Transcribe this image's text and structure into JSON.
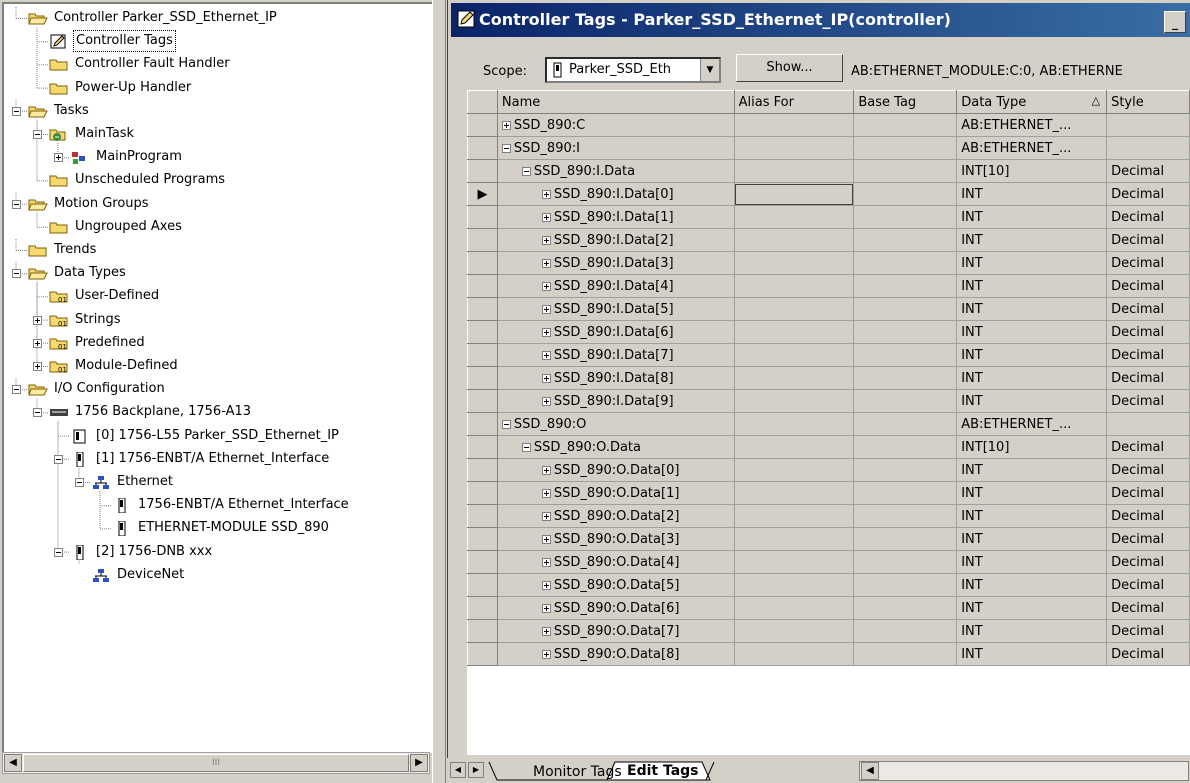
{
  "organizer": {
    "items": [
      {
        "label": "Controller Parker_SSD_Ethernet_IP",
        "icon": "folder-open-icon"
      },
      {
        "label": "Controller Tags",
        "icon": "tags-edit-icon"
      },
      {
        "label": "Controller Fault Handler",
        "icon": "folder-icon"
      },
      {
        "label": "Power-Up Handler",
        "icon": "folder-icon"
      },
      {
        "label": "Tasks",
        "icon": "folder-open-icon"
      },
      {
        "label": "MainTask",
        "icon": "task-icon"
      },
      {
        "label": "MainProgram",
        "icon": "program-icon"
      },
      {
        "label": "Unscheduled Programs",
        "icon": "folder-icon"
      },
      {
        "label": "Motion Groups",
        "icon": "folder-open-icon"
      },
      {
        "label": "Ungrouped Axes",
        "icon": "folder-icon"
      },
      {
        "label": "Trends",
        "icon": "folder-icon"
      },
      {
        "label": "Data Types",
        "icon": "folder-open-icon"
      },
      {
        "label": "User-Defined",
        "icon": "datatype-folder-icon"
      },
      {
        "label": "Strings",
        "icon": "datatype-folder-icon"
      },
      {
        "label": "Predefined",
        "icon": "datatype-folder-icon"
      },
      {
        "label": "Module-Defined",
        "icon": "datatype-folder-icon"
      },
      {
        "label": "I/O Configuration",
        "icon": "folder-open-icon"
      },
      {
        "label": "1756 Backplane, 1756-A13",
        "icon": "backplane-icon"
      },
      {
        "label": "[0] 1756-L55 Parker_SSD_Ethernet_IP",
        "icon": "controller-icon"
      },
      {
        "label": "[1] 1756-ENBT/A Ethernet_Interface",
        "icon": "module-icon"
      },
      {
        "label": "Ethernet",
        "icon": "network-icon"
      },
      {
        "label": "1756-ENBT/A Ethernet_Interface",
        "icon": "module-icon"
      },
      {
        "label": "ETHERNET-MODULE SSD_890",
        "icon": "module-icon"
      },
      {
        "label": "[2] 1756-DNB xxx",
        "icon": "module-icon"
      },
      {
        "label": "DeviceNet",
        "icon": "network-icon"
      }
    ],
    "scroll_thumb_label": "III"
  },
  "window": {
    "title": "Controller Tags - Parker_SSD_Ethernet_IP(controller)",
    "minimize_label": "_"
  },
  "scope": {
    "label": "Scope:",
    "value": "Parker_SSD_Eth",
    "show_button": "Show...",
    "filter_text": "AB:ETHERNET_MODULE:C:0, AB:ETHERNE"
  },
  "grid": {
    "columns": [
      "Name",
      "Alias For",
      "Base Tag",
      "Data Type",
      "Style"
    ],
    "sort_indicator": "△",
    "rows": [
      {
        "name": "SSD_890:C",
        "type": "AB:ETHERNET_...",
        "style": ""
      },
      {
        "name": "SSD_890:I",
        "type": "AB:ETHERNET_...",
        "style": ""
      },
      {
        "name": "SSD_890:I.Data",
        "type": "INT[10]",
        "style": "Decimal"
      },
      {
        "name": "SSD_890:I.Data[0]",
        "type": "INT",
        "style": "Decimal"
      },
      {
        "name": "SSD_890:I.Data[1]",
        "type": "INT",
        "style": "Decimal"
      },
      {
        "name": "SSD_890:I.Data[2]",
        "type": "INT",
        "style": "Decimal"
      },
      {
        "name": "SSD_890:I.Data[3]",
        "type": "INT",
        "style": "Decimal"
      },
      {
        "name": "SSD_890:I.Data[4]",
        "type": "INT",
        "style": "Decimal"
      },
      {
        "name": "SSD_890:I.Data[5]",
        "type": "INT",
        "style": "Decimal"
      },
      {
        "name": "SSD_890:I.Data[6]",
        "type": "INT",
        "style": "Decimal"
      },
      {
        "name": "SSD_890:I.Data[7]",
        "type": "INT",
        "style": "Decimal"
      },
      {
        "name": "SSD_890:I.Data[8]",
        "type": "INT",
        "style": "Decimal"
      },
      {
        "name": "SSD_890:I.Data[9]",
        "type": "INT",
        "style": "Decimal"
      },
      {
        "name": "SSD_890:O",
        "type": "AB:ETHERNET_...",
        "style": ""
      },
      {
        "name": "SSD_890:O.Data",
        "type": "INT[10]",
        "style": "Decimal"
      },
      {
        "name": "SSD_890:O.Data[0]",
        "type": "INT",
        "style": "Decimal"
      },
      {
        "name": "SSD_890:O.Data[1]",
        "type": "INT",
        "style": "Decimal"
      },
      {
        "name": "SSD_890:O.Data[2]",
        "type": "INT",
        "style": "Decimal"
      },
      {
        "name": "SSD_890:O.Data[3]",
        "type": "INT",
        "style": "Decimal"
      },
      {
        "name": "SSD_890:O.Data[4]",
        "type": "INT",
        "style": "Decimal"
      },
      {
        "name": "SSD_890:O.Data[5]",
        "type": "INT",
        "style": "Decimal"
      },
      {
        "name": "SSD_890:O.Data[6]",
        "type": "INT",
        "style": "Decimal"
      },
      {
        "name": "SSD_890:O.Data[7]",
        "type": "INT",
        "style": "Decimal"
      },
      {
        "name": "SSD_890:O.Data[8]",
        "type": "INT",
        "style": "Decimal"
      }
    ],
    "current_row_marker": "▶"
  },
  "tabs": {
    "monitor": "Monitor Tags",
    "edit": "Edit Tags"
  },
  "colors": {
    "title_start": "#0a246a",
    "title_end": "#3a6ea5",
    "folder": "#f6d870"
  }
}
